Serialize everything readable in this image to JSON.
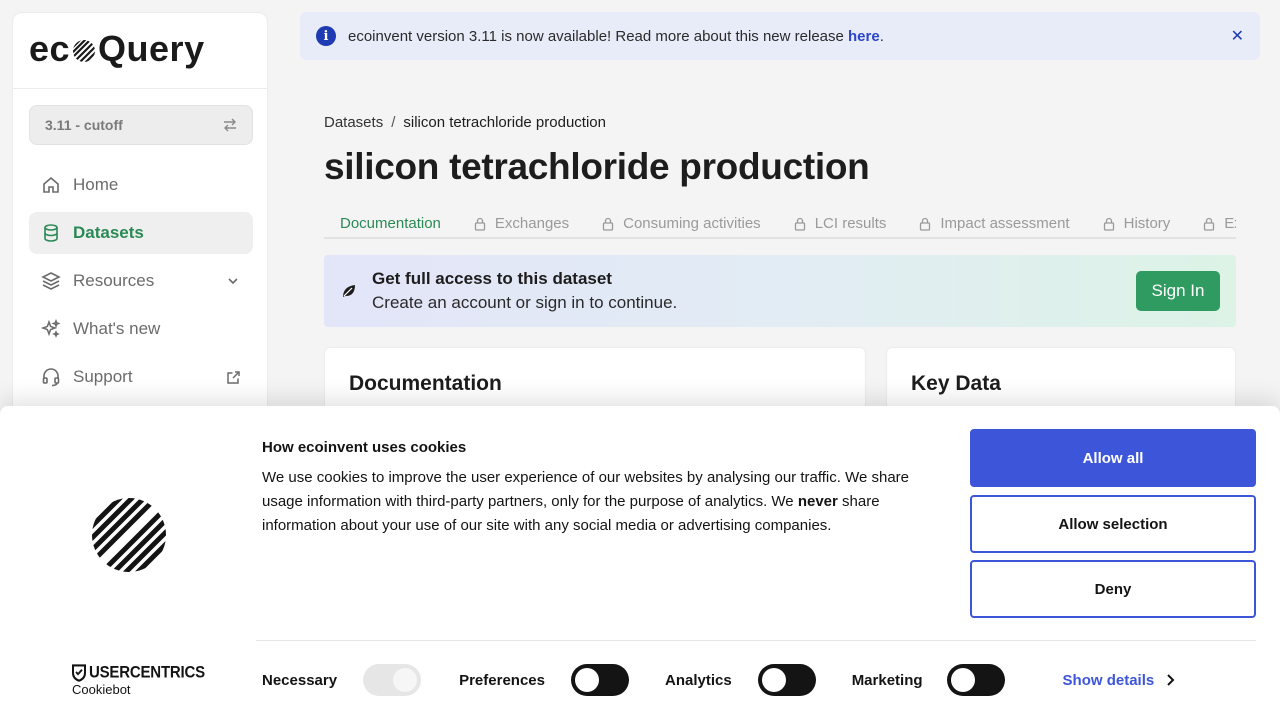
{
  "sidebar": {
    "logo_left": "ec",
    "logo_right": "Query",
    "version_label": "3.11 - cutoff",
    "items": [
      {
        "label": "Home",
        "icon": "home-icon"
      },
      {
        "label": "Datasets",
        "icon": "database-icon"
      },
      {
        "label": "Resources",
        "icon": "layers-icon"
      },
      {
        "label": "What's new",
        "icon": "sparkles-icon"
      },
      {
        "label": "Support",
        "icon": "headset-icon"
      }
    ]
  },
  "banner": {
    "text": "ecoinvent version 3.11 is now available! Read more about this new release ",
    "link": "here",
    "suffix": ".",
    "info_glyph": "i",
    "close_glyph": "✕",
    "accent": "#1e3bb3"
  },
  "breadcrumb": {
    "root": "Datasets",
    "separator": "/",
    "current": "silicon tetrachloride production"
  },
  "page_title": "silicon tetrachloride production",
  "tabs": [
    "Documentation",
    "Exchanges",
    "Consuming activities",
    "LCI results",
    "Impact assessment",
    "History",
    "Ex"
  ],
  "access": {
    "title": "Get full access to this dataset",
    "subtitle": "Create an account or sign in to continue.",
    "button": "Sign In",
    "accent": "#2f9b60"
  },
  "cards": {
    "documentation": "Documentation",
    "key_data": "Key Data"
  },
  "cookie": {
    "title": "How ecoinvent uses cookies",
    "text_a": "We use cookies to improve the user experience of our websites by analysing our traffic. We share usage information with third-party partners, only for the purpose of analytics. We ",
    "text_bold": "never",
    "text_b": " share information about your use of our site with any social media or advertising companies.",
    "allow_all": "Allow all",
    "allow_selection": "Allow selection",
    "deny": "Deny",
    "brand": "USERCENTRICS",
    "brand_sub": "Cookiebot",
    "toggles": [
      {
        "label": "Necessary",
        "state": "on-disabled"
      },
      {
        "label": "Preferences",
        "state": "off"
      },
      {
        "label": "Analytics",
        "state": "off"
      },
      {
        "label": "Marketing",
        "state": "off"
      }
    ],
    "show_details": "Show details",
    "accent": "#3d56d9"
  }
}
